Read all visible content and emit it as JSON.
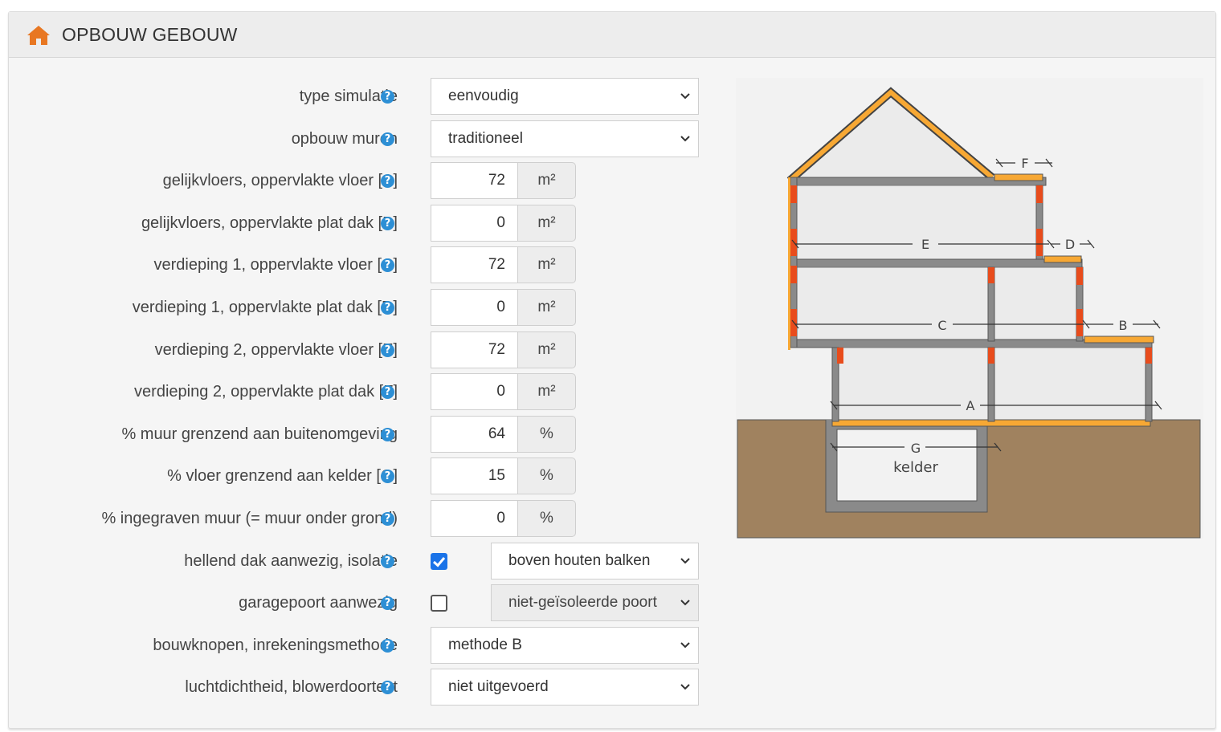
{
  "header": {
    "title": "OPBOUW GEBOUW",
    "icon": "home-icon"
  },
  "colors": {
    "accent": "#e87722",
    "help": "#2d8fd5",
    "checkbox": "#1a73e8",
    "insulation": "#f7a834",
    "ground": "#a0825f"
  },
  "fields": [
    {
      "id": "type-simulatie",
      "label": "type simulatie",
      "kind": "select",
      "value": "eenvoudig"
    },
    {
      "id": "opbouw-muren",
      "label": "opbouw muren",
      "kind": "select",
      "value": "traditioneel"
    },
    {
      "id": "gelijkvloers-vloer-a",
      "label": "gelijkvloers, oppervlakte vloer [A]",
      "kind": "number",
      "value": "72",
      "unit": "m²"
    },
    {
      "id": "gelijkvloers-plat-dak-b",
      "label": "gelijkvloers, oppervlakte plat dak [B]",
      "kind": "number",
      "value": "0",
      "unit": "m²"
    },
    {
      "id": "verdieping1-vloer-c",
      "label": "verdieping 1, oppervlakte vloer [C]",
      "kind": "number",
      "value": "72",
      "unit": "m²"
    },
    {
      "id": "verdieping1-plat-dak-d",
      "label": "verdieping 1, oppervlakte plat dak [D]",
      "kind": "number",
      "value": "0",
      "unit": "m²"
    },
    {
      "id": "verdieping2-vloer-e",
      "label": "verdieping 2, oppervlakte vloer [E]",
      "kind": "number",
      "value": "72",
      "unit": "m²"
    },
    {
      "id": "verdieping2-plat-dak-f",
      "label": "verdieping 2, oppervlakte plat dak [F]",
      "kind": "number",
      "value": "0",
      "unit": "m²"
    },
    {
      "id": "muur-buitenomgeving",
      "label": "% muur grenzend aan buitenomgeving",
      "kind": "number",
      "value": "64",
      "unit": "%"
    },
    {
      "id": "vloer-kelder-g",
      "label": "% vloer grenzend aan kelder [G]",
      "kind": "number",
      "value": "15",
      "unit": "%"
    },
    {
      "id": "ingegraven-muur",
      "label": "% ingegraven muur (= muur onder grond)",
      "kind": "number",
      "value": "0",
      "unit": "%"
    },
    {
      "id": "hellend-dak",
      "label": "hellend dak aanwezig, isolatie",
      "kind": "check-select",
      "checked": true,
      "value": "boven houten balken"
    },
    {
      "id": "garagepoort",
      "label": "garagepoort aanwezig",
      "kind": "check-select",
      "checked": false,
      "value": "niet-geïsoleerde poort"
    },
    {
      "id": "bouwknopen",
      "label": "bouwknopen, inrekeningsmethode",
      "kind": "select",
      "value": "methode B"
    },
    {
      "id": "luchtdichtheid",
      "label": "luchtdichtheid, blowerdoortest",
      "kind": "select",
      "value": "niet uitgevoerd"
    }
  ],
  "diagram": {
    "labels": {
      "A": "A",
      "B": "B",
      "C": "C",
      "D": "D",
      "E": "E",
      "F": "F",
      "G": "G",
      "kelder": "kelder"
    }
  }
}
